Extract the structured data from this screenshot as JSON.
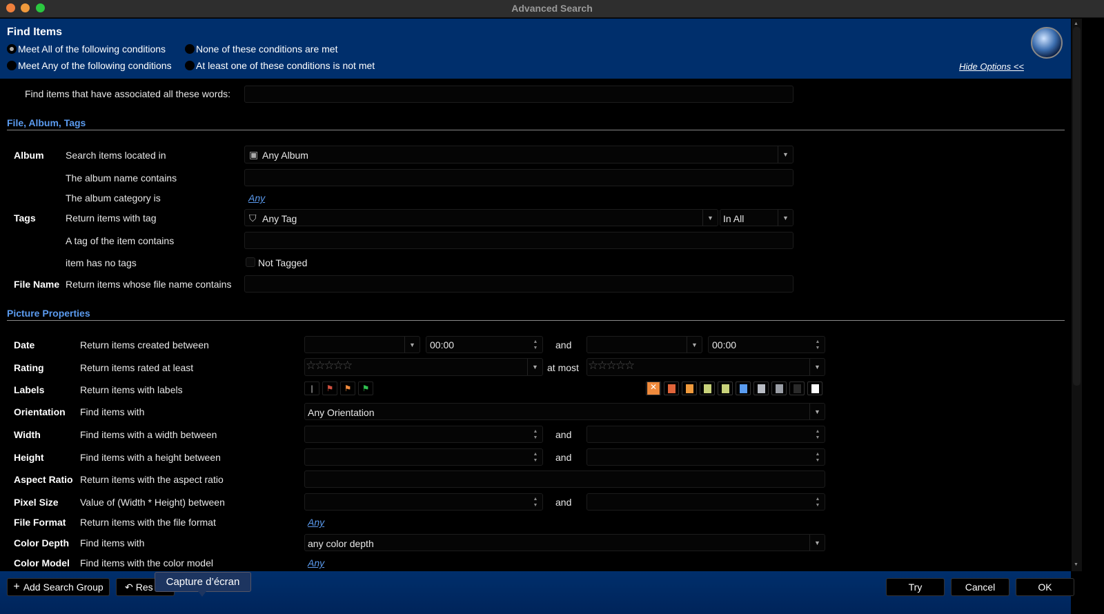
{
  "window": {
    "title": "Advanced Search"
  },
  "header": {
    "title": "Find Items",
    "options": [
      "Meet All of the following conditions",
      "None of these conditions are met",
      "Meet Any of the following conditions",
      "At least one of these conditions is not met"
    ],
    "selected": 0,
    "hide_options": "Hide Options <<"
  },
  "words": {
    "label": "Find items that have associated all these words:",
    "value": ""
  },
  "sections": {
    "file": "File, Album, Tags",
    "picture": "Picture Properties"
  },
  "album": {
    "group": "Album",
    "search_in": "Search items located in",
    "album_value": "Any Album",
    "name_contains": "The album name contains",
    "category": "The album category is",
    "category_value": "Any"
  },
  "tags": {
    "group": "Tags",
    "with_tag": "Return items with tag",
    "tag_value": "Any Tag",
    "match_value": "In All",
    "tag_contains": "A tag of the item contains",
    "no_tags": "item has no tags",
    "not_tagged": "Not Tagged"
  },
  "filename": {
    "group": "File Name",
    "label": "Return items whose file name contains"
  },
  "date": {
    "group": "Date",
    "label": "Return items created between",
    "time1": "00:00",
    "and": "and",
    "time2": "00:00"
  },
  "rating": {
    "group": "Rating",
    "label": "Return items rated at least",
    "at_most": "at most",
    "min": 0,
    "max": 0
  },
  "labels": {
    "group": "Labels",
    "label": "Return items with labels",
    "colors": [
      "#f08a3c",
      "#e0643a",
      "#f09a3c",
      "#c8d27a",
      "#c8d27a",
      "#5a9cf0",
      "#b8bcc4",
      "#9a9ea6",
      "#2a2a2a",
      "#ffffff"
    ]
  },
  "orientation": {
    "group": "Orientation",
    "label": "Find items with",
    "value": "Any Orientation"
  },
  "width": {
    "group": "Width",
    "label": "Find items with a width between",
    "and": "and"
  },
  "height": {
    "group": "Height",
    "label": "Find items with a height between",
    "and": "and"
  },
  "aspect": {
    "group": "Aspect Ratio",
    "label": "Return items with the aspect ratio"
  },
  "pixel": {
    "group": "Pixel Size",
    "label": "Value of (Width * Height) between",
    "and": "and"
  },
  "format": {
    "group": "File Format",
    "label": "Return items with the file format",
    "value": "Any"
  },
  "depth": {
    "group": "Color Depth",
    "label": "Find items with",
    "value": "any color depth"
  },
  "model": {
    "group": "Color Model",
    "label": "Find items with the color model",
    "value": "Any"
  },
  "footer": {
    "add_group": "Add Search Group",
    "reset": "Res",
    "tooltip": "Capture d’écran",
    "try": "Try",
    "cancel": "Cancel",
    "ok": "OK"
  }
}
